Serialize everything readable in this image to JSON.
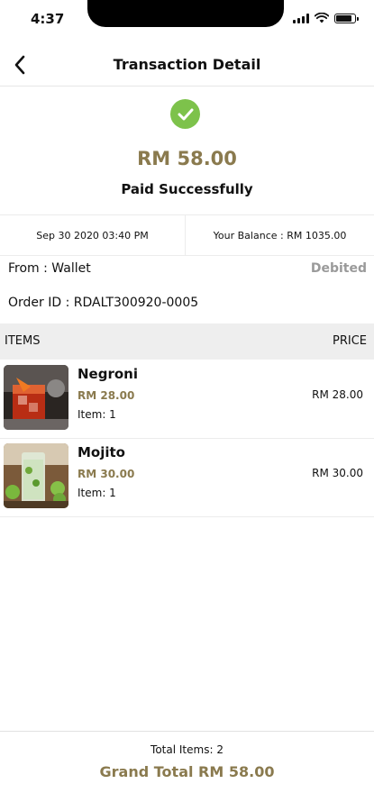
{
  "status_bar": {
    "time": "4:37"
  },
  "header": {
    "title": "Transaction Detail",
    "back_icon": "chevron-left-icon"
  },
  "summary": {
    "icon": "check-circle-icon",
    "icon_color": "#7dc24b",
    "amount": "RM 58.00",
    "status": "Paid Successfully",
    "accent_color": "#8a7a4e"
  },
  "info": {
    "datetime": "Sep 30 2020 03:40 PM",
    "balance": "Your Balance : RM 1035.00"
  },
  "source": {
    "from": "From : Wallet",
    "status": "Debited",
    "order_id": "Order ID : RDALT300920-0005"
  },
  "items_table": {
    "header_items": "ITEMS",
    "header_price": "PRICE",
    "rows": [
      {
        "name": "Negroni",
        "unit_price": "RM 28.00",
        "quantity": "Item: 1",
        "price": "RM 28.00"
      },
      {
        "name": "Mojito",
        "unit_price": "RM 30.00",
        "quantity": "Item: 1",
        "price": "RM 30.00"
      }
    ]
  },
  "footer": {
    "total_items": "Total Items: 2",
    "grand_total": "Grand Total RM 58.00"
  }
}
